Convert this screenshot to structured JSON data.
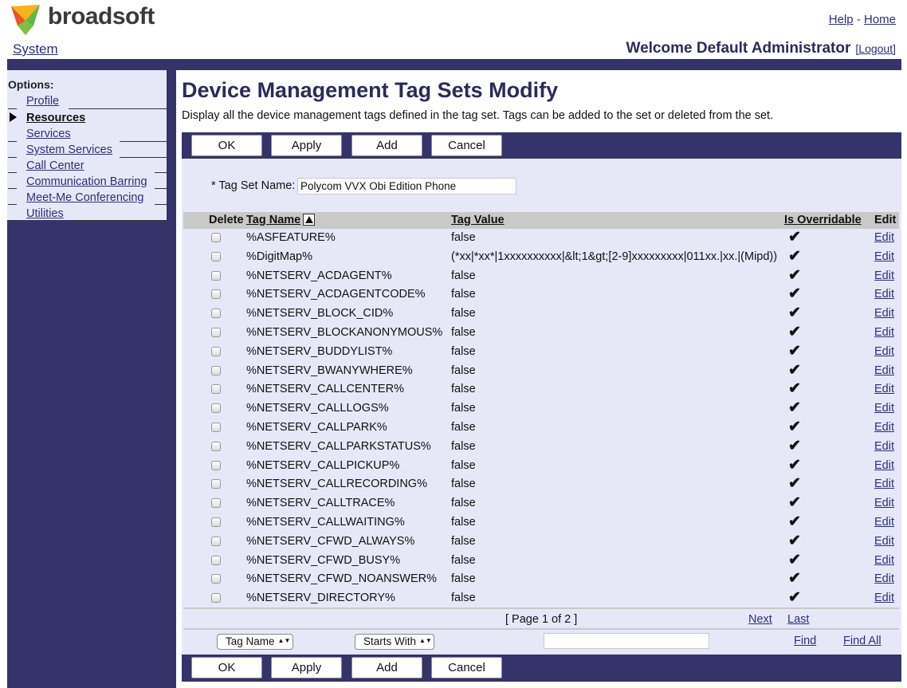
{
  "header": {
    "brand": "broadsoft",
    "help": "Help",
    "separator": "-",
    "home": "Home",
    "system": "System",
    "welcome": "Welcome Default Administrator",
    "logout": "[Logout]"
  },
  "sidebar": {
    "title": "Options:",
    "items": [
      {
        "label": "Profile"
      },
      {
        "label": "Resources"
      },
      {
        "label": "Services"
      },
      {
        "label": "System Services"
      },
      {
        "label": "Call Center"
      },
      {
        "label": "Communication Barring"
      },
      {
        "label": "Meet-Me Conferencing"
      },
      {
        "label": "Utilities"
      }
    ]
  },
  "page": {
    "title": "Device Management Tag Sets Modify",
    "description": "Display all the device management tags defined in the tag set. Tags can be added to the set or deleted from the set."
  },
  "buttons": {
    "ok": "OK",
    "apply": "Apply",
    "add": "Add",
    "cancel": "Cancel"
  },
  "form": {
    "tag_set_label": "* Tag Set Name:",
    "tag_set_value": "Polycom VVX Obi Edition Phone"
  },
  "table": {
    "headers": {
      "delete": "Delete",
      "tag_name": "Tag Name",
      "tag_value": "Tag Value",
      "is_overridable": "Is Overridable",
      "edit": "Edit"
    },
    "check_glyph": "✔",
    "edit_label": "Edit",
    "rows": [
      {
        "name": "%ASFEATURE%",
        "value": "false"
      },
      {
        "name": "%DigitMap%",
        "value": "(*xx|*xx*|1xxxxxxxxxx|&lt;1&gt;[2-9]xxxxxxxxx|011xx.|xx.|(Mipd))"
      },
      {
        "name": "%NETSERV_ACDAGENT%",
        "value": "false"
      },
      {
        "name": "%NETSERV_ACDAGENTCODE%",
        "value": "false"
      },
      {
        "name": "%NETSERV_BLOCK_CID%",
        "value": "false"
      },
      {
        "name": "%NETSERV_BLOCKANONYMOUS%",
        "value": "false"
      },
      {
        "name": "%NETSERV_BUDDYLIST%",
        "value": "false"
      },
      {
        "name": "%NETSERV_BWANYWHERE%",
        "value": "false"
      },
      {
        "name": "%NETSERV_CALLCENTER%",
        "value": "false"
      },
      {
        "name": "%NETSERV_CALLLOGS%",
        "value": "false"
      },
      {
        "name": "%NETSERV_CALLPARK%",
        "value": "false"
      },
      {
        "name": "%NETSERV_CALLPARKSTATUS%",
        "value": "false"
      },
      {
        "name": "%NETSERV_CALLPICKUP%",
        "value": "false"
      },
      {
        "name": "%NETSERV_CALLRECORDING%",
        "value": "false"
      },
      {
        "name": "%NETSERV_CALLTRACE%",
        "value": "false"
      },
      {
        "name": "%NETSERV_CALLWAITING%",
        "value": "false"
      },
      {
        "name": "%NETSERV_CFWD_ALWAYS%",
        "value": "false"
      },
      {
        "name": "%NETSERV_CFWD_BUSY%",
        "value": "false"
      },
      {
        "name": "%NETSERV_CFWD_NOANSWER%",
        "value": "false"
      },
      {
        "name": "%NETSERV_DIRECTORY%",
        "value": "false"
      }
    ]
  },
  "pager": {
    "text": "[ Page 1 of 2 ]",
    "next": "Next",
    "last": "Last"
  },
  "search": {
    "field": "Tag Name",
    "mode": "Starts With",
    "arrows": "▲▼",
    "query": "",
    "find": "Find",
    "find_all": "Find All"
  },
  "colors": {
    "navy": "#34336a",
    "panel": "#e6e8f8",
    "header_gray": "#c9c9c9",
    "link": "#2b2f7a",
    "title": "#2b2a5b"
  }
}
